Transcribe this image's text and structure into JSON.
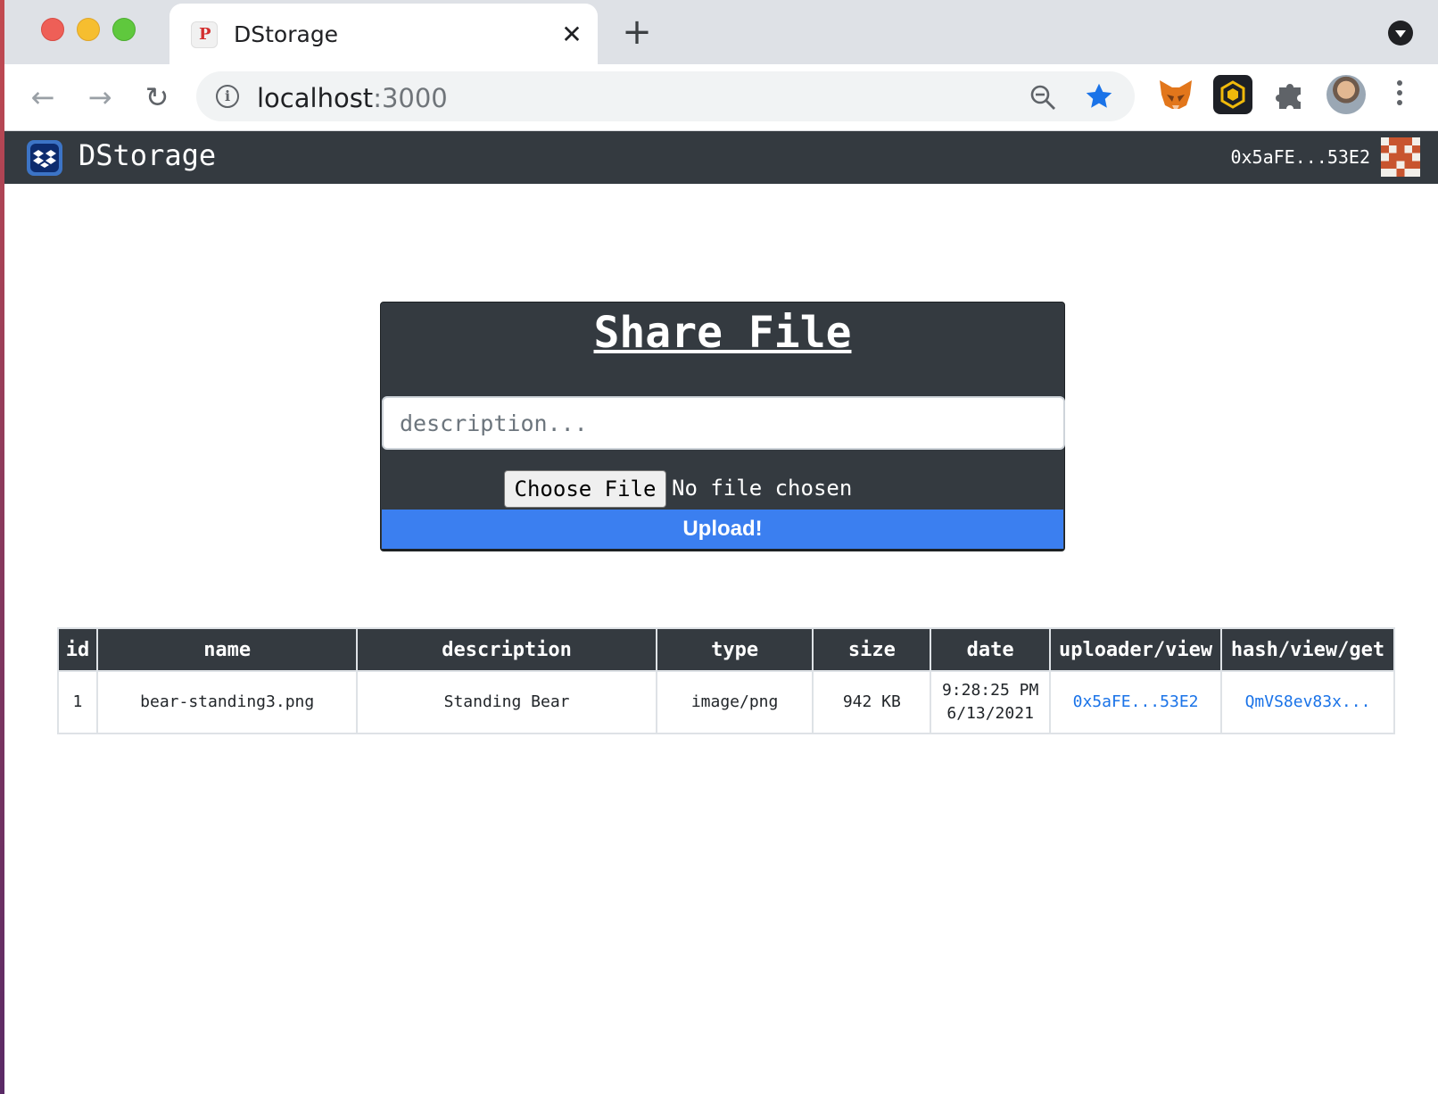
{
  "browser": {
    "tab_title": "DStorage",
    "tab_favicon_glyph": "P",
    "tab_close_glyph": "✕",
    "new_tab_glyph": "+",
    "url_host": "localhost",
    "url_port": ":3000",
    "back_glyph": "←",
    "forward_glyph": "→",
    "reload_glyph": "↻",
    "info_glyph": "i",
    "extensions": [
      "metamask-fox-icon",
      "binance-wallet-icon",
      "extensions-puzzle-icon"
    ],
    "accent_color": "#1a73e8"
  },
  "navbar": {
    "title": "DStorage",
    "account": "0x5aFE...53E2"
  },
  "upload_card": {
    "title": "Share File",
    "description_placeholder": "description...",
    "choose_file_label": "Choose File",
    "no_file_label": "No file chosen",
    "upload_label": "Upload!"
  },
  "table": {
    "headers": [
      "id",
      "name",
      "description",
      "type",
      "size",
      "date",
      "uploader/view",
      "hash/view/get"
    ],
    "rows": [
      {
        "id": "1",
        "name": "bear-standing3.png",
        "description": "Standing Bear",
        "type": "image/png",
        "size": "942 KB",
        "time": "9:28:25 PM",
        "date": "6/13/2021",
        "uploader": "0x5aFE...53E2",
        "hash": "QmVS8ev83x..."
      }
    ]
  },
  "colors": {
    "navbar_bg": "#343a40",
    "upload_button": "#3b7ff0",
    "link": "#1a73e8"
  }
}
